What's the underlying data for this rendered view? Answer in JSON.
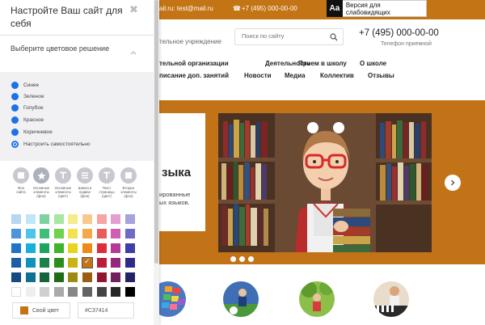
{
  "accent_color": "#c37414",
  "link_color": "#1a73e8",
  "site": {
    "topbar": {
      "email": "ail.ru: test@mail.ru",
      "phone": "+7 (495) 000-00-00",
      "access_icon_text": "Aa",
      "access_label": "Версия для слабовидящих"
    },
    "org_type": "тельное учреждение",
    "search_placeholder": "Поиск по сайту",
    "phone_big": "+7 (495) 000-00-00",
    "phone_sub": "Телефон приемной",
    "nav_row1": [
      "тельной организации",
      "Деятельность",
      "Прием в школу",
      "О школе"
    ],
    "nav_row2": [
      "писание доп. занятий",
      "Новости",
      "Медиа",
      "Коллектив",
      "Отзывы"
    ],
    "slide": {
      "title": "зыка",
      "text": "ированные\nых языков."
    }
  },
  "panel": {
    "title": "Настройте Ваш сайт для себя",
    "section_label": "Выберите цветовое решение",
    "options": [
      "Синее",
      "Зеленое",
      "Голубое",
      "Красное",
      "Коричневое",
      "Настроить самостоятельно"
    ],
    "selected_option": 5,
    "tools": [
      {
        "caption": "Фон\nсайта",
        "icon": "square-icon"
      },
      {
        "caption": "Основные\nэлементы\n(фон)",
        "icon": "star-icon"
      },
      {
        "caption": "Основные\nэлементы\n(цвет)",
        "icon": "text-t-icon"
      },
      {
        "caption": "Шапка и\nподвал\n(фон)",
        "icon": "list-icon"
      },
      {
        "caption": "Текст\nстраницы\n(цвет)",
        "icon": "text-t-icon"
      },
      {
        "caption": "Вторые\nэлементы\n(фон)",
        "icon": "square-icon"
      }
    ],
    "swatch_rows": [
      [
        "#b7d6f2",
        "#bfe7f7",
        "#7fd1a1",
        "#a8e6a1",
        "#f7ec8c",
        "#f7c98c",
        "#f5a5a5",
        "#e39fcd",
        "#a5a2dc"
      ],
      [
        "#4c95dd",
        "#4dc5ea",
        "#3dbf78",
        "#6fd14d",
        "#f1e24e",
        "#f3a949",
        "#ea5c5c",
        "#cf60b1",
        "#6d6ac9"
      ],
      [
        "#1f74c9",
        "#18b0d9",
        "#1ea45c",
        "#3fb32a",
        "#e9d41b",
        "#ee8a16",
        "#dd2d3c",
        "#b63899",
        "#403da8"
      ],
      [
        "#1a5ea5",
        "#0f93b8",
        "#188249",
        "#2b8e1c",
        "#c9b315",
        "#c37414",
        "#b81e3a",
        "#93287c",
        "#2f2c87"
      ],
      [
        "#164a80",
        "#0c7290",
        "#13663a",
        "#1e6c14",
        "#9c8a11",
        "#9c5c10",
        "#8e1630",
        "#701f5f",
        "#24226a"
      ],
      [
        "#ffffff",
        "#eeeeee",
        "#cfcfcf",
        "#aaaaaa",
        "#878787",
        "#636363",
        "#444444",
        "#262626",
        "#000000"
      ]
    ],
    "selected_swatch": {
      "row": 3,
      "col": 5
    },
    "own_color_label": "Свой цвет",
    "hex_value": "#C37414"
  }
}
